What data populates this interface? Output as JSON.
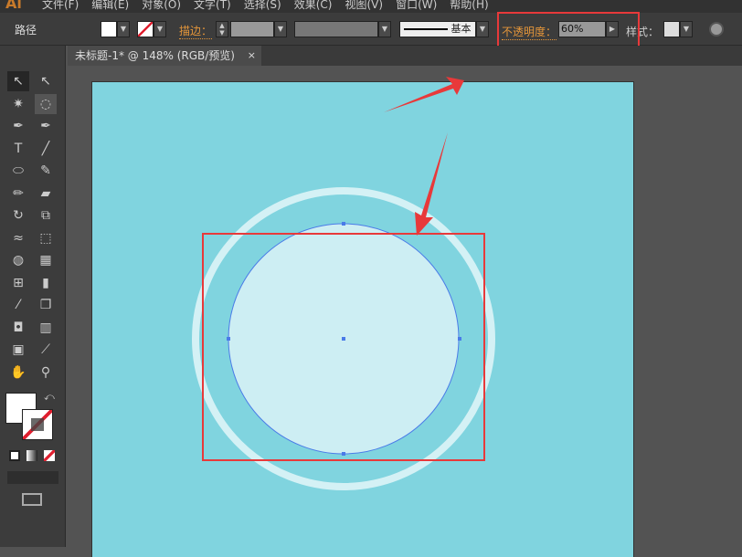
{
  "app": {
    "logo": "Ai",
    "menu": [
      "文件(F)",
      "编辑(E)",
      "对象(O)",
      "文字(T)",
      "选择(S)",
      "效果(C)",
      "视图(V)",
      "窗口(W)",
      "帮助(H)"
    ]
  },
  "control": {
    "selection_label": "路径",
    "stroke_label": "描边：",
    "brush_label": "基本",
    "opacity_label": "不透明度：",
    "opacity_value": "60%",
    "style_label": "样式："
  },
  "document": {
    "tab_title": "未标题-1* @ 148% (RGB/预览)",
    "close": "×"
  },
  "colors": {
    "artboard": "#80d4df",
    "circle_fill": "#cdeef3",
    "ring": "#d4f1f5",
    "selection": "#4a7be8",
    "annotation": "#e8393a"
  },
  "tools": [
    "selection",
    "direct-selection",
    "magic-wand",
    "lasso",
    "pen",
    "curvature",
    "type",
    "line",
    "ellipse",
    "paintbrush",
    "pencil",
    "eraser",
    "rotate",
    "scale",
    "warp",
    "free-transform",
    "shape-builder",
    "perspective-grid",
    "mesh",
    "gradient",
    "eyedropper",
    "blend",
    "symbol-sprayer",
    "column-graph",
    "artboard",
    "slice",
    "hand",
    "zoom"
  ]
}
